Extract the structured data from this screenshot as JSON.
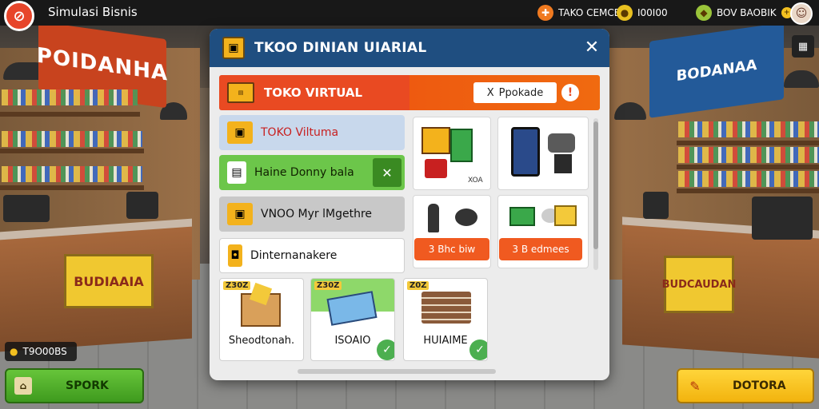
{
  "app": {
    "title": "Simulasi Bisnis",
    "logo_icon": "store-logo-icon"
  },
  "topbar": {
    "resources": [
      {
        "icon": "orange-coin-icon",
        "value": "ᴛᴀᴋᴏ ᴄᴇᴍᴄᴇ",
        "display": "TAKO CEMCE",
        "color": "#f07a20"
      },
      {
        "icon": "gold-coin-icon",
        "value": "I00I00",
        "display": "I00I00",
        "color": "#e8c020"
      },
      {
        "icon": "green-gem-icon",
        "value": "BOV BAOBIK",
        "display": "BOV BAOBIK",
        "color": "#9ac43a"
      }
    ],
    "avatar_icon": "user-avatar-icon"
  },
  "background": {
    "left_sign": "POIDANHA",
    "right_sign": "BODANAA",
    "left_counter_sign": "BUDIAAIA",
    "right_counter_sign": "BUDCAUDAN"
  },
  "modal": {
    "title": "TKOO DINIAN UIARIAL",
    "close_symbol": "✕",
    "banner": {
      "label": "TOKO VIRTUAL",
      "upgrade_label": "Ppokade",
      "upgrade_prefix": "X",
      "info_symbol": "!"
    },
    "sidebar": [
      {
        "label": "TOKO Viltuma",
        "icon": "box-icon",
        "state": "selected",
        "color": "#c8d8ec"
      },
      {
        "label": "Haine Donny bala",
        "icon": "document-icon",
        "state": "active",
        "color": "#6cc64a"
      },
      {
        "label": "VNOO Myr lMgethre",
        "icon": "crate-icon",
        "state": "normal",
        "color": "#c8c8c8"
      },
      {
        "label": "Dinternanakere",
        "icon": "backpack-icon",
        "state": "normal",
        "color": "#ffffff"
      }
    ],
    "grid_cards": [
      {
        "icon": "snacks-icon",
        "caption": "XOA"
      },
      {
        "icon": "tablet-camera-icon",
        "caption": ""
      },
      {
        "icon": "tools-icon",
        "caption": ""
      },
      {
        "icon": "toys-icon",
        "caption": ""
      }
    ],
    "grid_buttons": [
      "3 Bhc biw",
      "3 B edmees"
    ],
    "products": [
      {
        "price": "Z30Z",
        "name": "Sheodtonah.",
        "icon": "food-box-icon",
        "checked": false
      },
      {
        "price": "Z30Z",
        "name": "ISOAIO",
        "icon": "book-icon",
        "checked": true
      },
      {
        "price": "Z0Z",
        "name": "HUIAIME",
        "icon": "book-stack-icon",
        "checked": true
      }
    ]
  },
  "footer": {
    "money": "T9O00BS",
    "left_button": "SPORK",
    "right_button": "DOTORA"
  }
}
